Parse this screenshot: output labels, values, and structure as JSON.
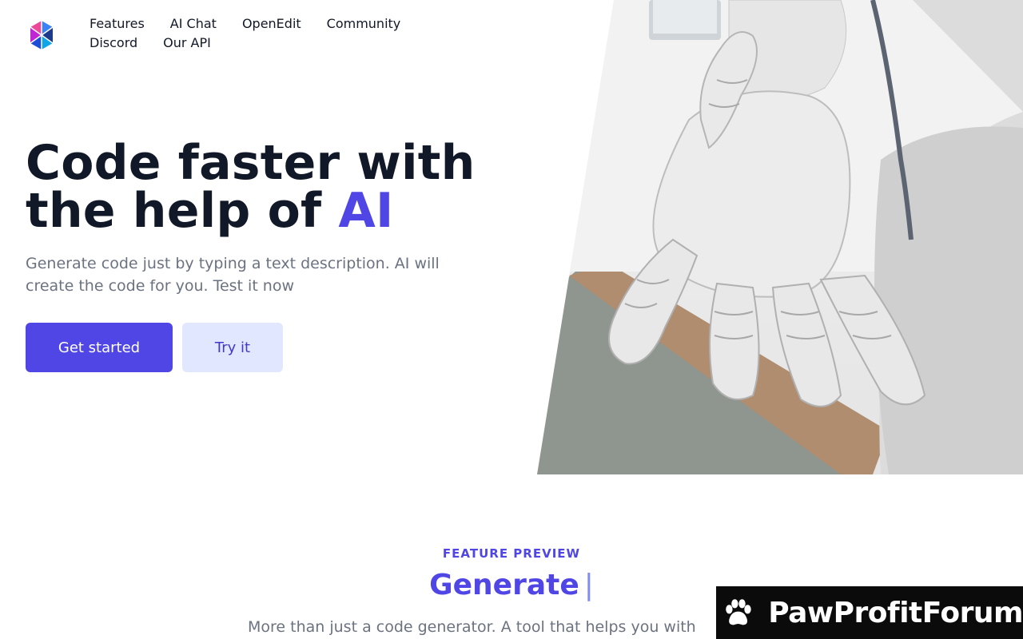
{
  "nav": {
    "items": [
      {
        "label": "Features"
      },
      {
        "label": "AI Chat"
      },
      {
        "label": "OpenEdit"
      },
      {
        "label": "Community"
      },
      {
        "label": "Discord"
      },
      {
        "label": "Our API"
      }
    ]
  },
  "hero": {
    "title_line1": "Code faster with",
    "title_line2_prefix": "the help of",
    "title_accent": "AI",
    "subtitle": "Generate code just by typing a text description. AI will create the code for you. Test it now",
    "primary_button": "Get started",
    "secondary_button": "Try it",
    "image_icon": "robot-hand-photo"
  },
  "feature": {
    "eyebrow": "FEATURE PREVIEW",
    "title": "Generate",
    "cursor": "|",
    "description": "More than just a code generator. A tool that helps you with"
  },
  "watermark": {
    "text": "PawProfitForum",
    "icon": "paw-icon"
  },
  "colors": {
    "accent": "#4f46e5",
    "accent_light": "#e0e7ff",
    "heading": "#111827",
    "muted": "#6b7280"
  }
}
